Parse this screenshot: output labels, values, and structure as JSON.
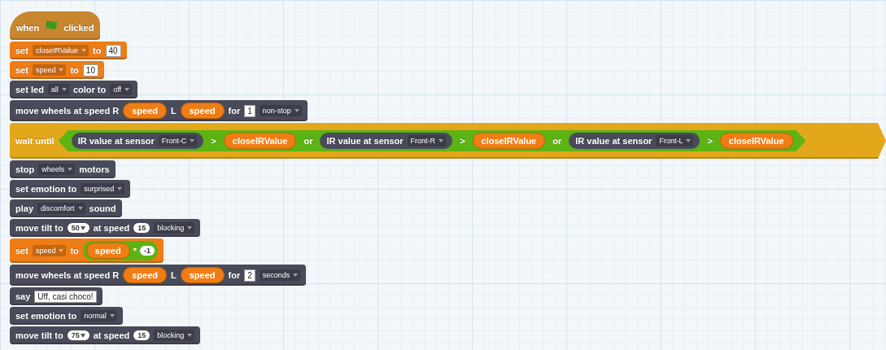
{
  "script": [
    {
      "kind": "hat",
      "color": "#c8862f",
      "parts": [
        {
          "kind": "label",
          "text": "when"
        },
        {
          "kind": "flag"
        },
        {
          "kind": "label",
          "text": "clicked"
        }
      ]
    },
    {
      "kind": "command",
      "color": "#ee7d16",
      "parts": [
        {
          "kind": "label",
          "text": "set"
        },
        {
          "kind": "dropdown",
          "text": "closeIRValue"
        },
        {
          "kind": "label",
          "text": "to"
        },
        {
          "kind": "field",
          "text": "40"
        }
      ]
    },
    {
      "kind": "command",
      "color": "#ee7d16",
      "parts": [
        {
          "kind": "label",
          "text": "set"
        },
        {
          "kind": "dropdown",
          "text": "speed"
        },
        {
          "kind": "label",
          "text": "to"
        },
        {
          "kind": "field",
          "text": "10"
        }
      ]
    },
    {
      "kind": "command",
      "color": "#4a4b5a",
      "parts": [
        {
          "kind": "label",
          "text": "set led"
        },
        {
          "kind": "dropdown",
          "text": "all"
        },
        {
          "kind": "label",
          "text": "color to"
        },
        {
          "kind": "dropdown",
          "text": "off"
        }
      ]
    },
    {
      "kind": "command",
      "color": "#4a4b5a",
      "parts": [
        {
          "kind": "label",
          "text": "move wheels at speed R"
        },
        {
          "kind": "variable",
          "text": "speed"
        },
        {
          "kind": "label",
          "text": "L"
        },
        {
          "kind": "variable",
          "text": "speed"
        },
        {
          "kind": "label",
          "text": "for"
        },
        {
          "kind": "field",
          "text": "1"
        },
        {
          "kind": "dropdown",
          "text": "non-stop"
        }
      ]
    },
    {
      "kind": "wide",
      "color": "#e3a71c",
      "parts": [
        {
          "kind": "label",
          "text": "wait until"
        },
        {
          "kind": "predicate",
          "children": [
            {
              "kind": "sensor",
              "children": [
                {
                  "kind": "label",
                  "text": "IR value at sensor"
                },
                {
                  "kind": "dropdown",
                  "text": "Front-C"
                }
              ]
            },
            {
              "kind": "label",
              "text": ">"
            },
            {
              "kind": "variable",
              "text": "closeIRValue"
            },
            {
              "kind": "label",
              "text": "or"
            },
            {
              "kind": "sensor",
              "children": [
                {
                  "kind": "label",
                  "text": "IR value at sensor"
                },
                {
                  "kind": "dropdown",
                  "text": "Front-R"
                }
              ]
            },
            {
              "kind": "label",
              "text": ">"
            },
            {
              "kind": "variable",
              "text": "closeIRValue"
            },
            {
              "kind": "label",
              "text": "or"
            },
            {
              "kind": "sensor",
              "children": [
                {
                  "kind": "label",
                  "text": "IR value at sensor"
                },
                {
                  "kind": "dropdown",
                  "text": "Front-L"
                }
              ]
            },
            {
              "kind": "label",
              "text": ">"
            },
            {
              "kind": "variable",
              "text": "closeIRValue"
            }
          ]
        }
      ]
    },
    {
      "kind": "command",
      "color": "#4a4b5a",
      "parts": [
        {
          "kind": "label",
          "text": "stop"
        },
        {
          "kind": "dropdown",
          "text": "wheels"
        },
        {
          "kind": "label",
          "text": "motors"
        }
      ]
    },
    {
      "kind": "command",
      "color": "#4a4b5a",
      "parts": [
        {
          "kind": "label",
          "text": "set emotion to"
        },
        {
          "kind": "dropdown",
          "text": "surprised"
        }
      ]
    },
    {
      "kind": "command",
      "color": "#4a4b5a",
      "parts": [
        {
          "kind": "label",
          "text": "play"
        },
        {
          "kind": "dropdown",
          "text": "discomfort"
        },
        {
          "kind": "label",
          "text": "sound"
        }
      ]
    },
    {
      "kind": "command",
      "color": "#4a4b5a",
      "parts": [
        {
          "kind": "label",
          "text": "move tilt to"
        },
        {
          "kind": "round",
          "text": "50",
          "menu": true
        },
        {
          "kind": "label",
          "text": "at speed"
        },
        {
          "kind": "round",
          "text": "15",
          "menu": false
        },
        {
          "kind": "dropdown",
          "text": "blocking"
        }
      ]
    },
    {
      "kind": "command",
      "color": "#ee7d16",
      "parts": [
        {
          "kind": "label",
          "text": "set"
        },
        {
          "kind": "dropdown",
          "text": "speed"
        },
        {
          "kind": "label",
          "text": "to"
        },
        {
          "kind": "operator",
          "children": [
            {
              "kind": "variable",
              "text": "speed"
            },
            {
              "kind": "label",
              "text": "*"
            },
            {
              "kind": "round",
              "text": "-1",
              "menu": false
            }
          ]
        }
      ]
    },
    {
      "kind": "command",
      "color": "#4a4b5a",
      "parts": [
        {
          "kind": "label",
          "text": "move wheels at speed R"
        },
        {
          "kind": "variable",
          "text": "speed"
        },
        {
          "kind": "label",
          "text": "L"
        },
        {
          "kind": "variable",
          "text": "speed"
        },
        {
          "kind": "label",
          "text": "for"
        },
        {
          "kind": "field",
          "text": "2"
        },
        {
          "kind": "dropdown",
          "text": "seconds"
        }
      ]
    },
    {
      "kind": "command",
      "color": "#4a4b5a",
      "parts": [
        {
          "kind": "label",
          "text": "say"
        },
        {
          "kind": "field",
          "text": "Uff, casi choco!"
        }
      ]
    },
    {
      "kind": "command",
      "color": "#4a4b5a",
      "parts": [
        {
          "kind": "label",
          "text": "set emotion to"
        },
        {
          "kind": "dropdown",
          "text": "normal"
        }
      ]
    },
    {
      "kind": "command",
      "color": "#4a4b5a",
      "parts": [
        {
          "kind": "label",
          "text": "move tilt to"
        },
        {
          "kind": "round",
          "text": "75",
          "menu": true
        },
        {
          "kind": "label",
          "text": "at speed"
        },
        {
          "kind": "round",
          "text": "15",
          "menu": false
        },
        {
          "kind": "dropdown",
          "text": "blocking"
        }
      ]
    }
  ]
}
